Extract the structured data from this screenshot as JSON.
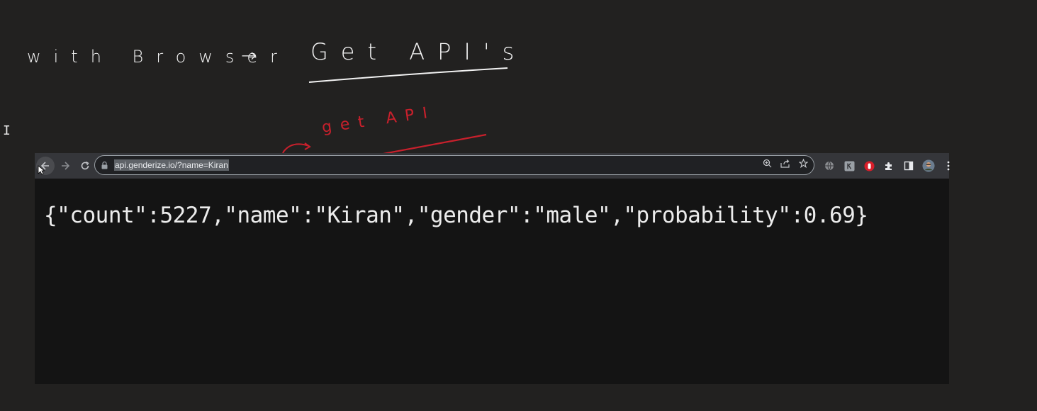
{
  "annotations": {
    "line1_left": "with Browser",
    "arrow": "→",
    "line1_right": "Get API's",
    "red_note": "get API"
  },
  "browser": {
    "url": "api.genderize.io/?name=Kiran",
    "response_body": "{\"count\":5227,\"name\":\"Kiran\",\"gender\":\"male\",\"probability\":0.69}"
  },
  "colors": {
    "canvas_bg": "#222120",
    "ink_white": "#f2f2f2",
    "ink_red": "#c8202c",
    "toolbar_bg": "#35363a",
    "page_bg": "#141414"
  },
  "icons": [
    "back-icon",
    "forward-icon",
    "reload-icon",
    "lock-icon",
    "zoom-icon",
    "share-icon",
    "bookmark-star-icon",
    "globe-extension-icon",
    "k-extension-icon",
    "red-extension-icon",
    "puzzle-icon",
    "side-panel-icon",
    "profile-avatar",
    "more-menu-icon",
    "text-cursor-icon",
    "mouse-pointer-icon"
  ]
}
